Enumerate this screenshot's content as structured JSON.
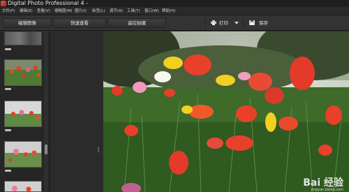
{
  "window": {
    "title": "Digital Photo Professional 4 -"
  },
  "menu": [
    {
      "label": "文件(F)"
    },
    {
      "label": "编辑(E)"
    },
    {
      "label": "查看(V)"
    },
    {
      "label": "缩略图(M)"
    },
    {
      "label": "图片(I)"
    },
    {
      "label": "标签(L)"
    },
    {
      "label": "调节(A)"
    },
    {
      "label": "工具(T)"
    },
    {
      "label": "窗口(W)"
    },
    {
      "label": "帮助(H)"
    }
  ],
  "toolbar": {
    "edit_image": "编辑图像",
    "quick_check": "快速查看",
    "remote_shooting": "遥控拍摄",
    "print": "打印",
    "save": "保存"
  },
  "watermark": {
    "brand": "Bai 经验",
    "sub": "jingyan.baidu.com"
  },
  "colors": {
    "accent_red": "#e33a2a",
    "panel_bg": "#262626",
    "toolbar_bg": "#333333"
  }
}
